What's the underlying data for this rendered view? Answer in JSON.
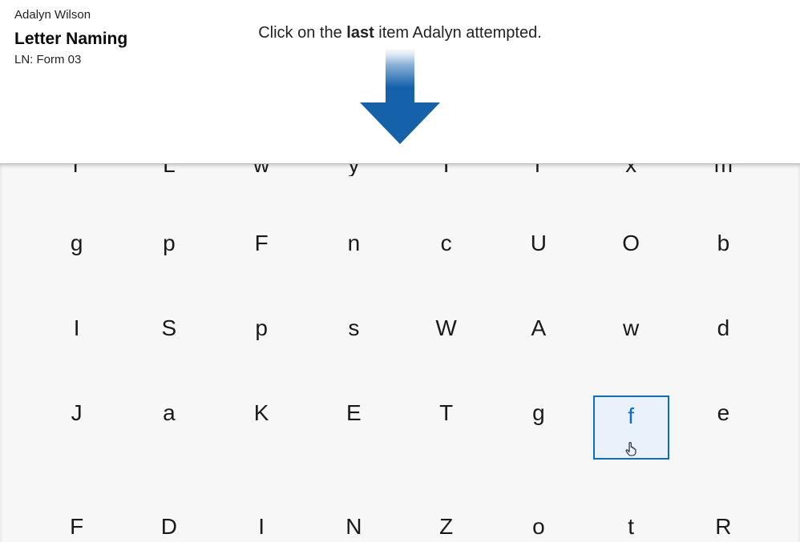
{
  "header": {
    "student_name": "Adalyn Wilson",
    "activity_name": "Letter Naming",
    "form_name": "LN: Form 03"
  },
  "instruction": {
    "prefix": "Click on the ",
    "bold": "last",
    "suffix": " item Adalyn attempted."
  },
  "grid": {
    "columns": 8,
    "selected": {
      "row": 3,
      "col": 6
    },
    "cells": [
      [
        "r",
        "L",
        "w",
        "y",
        "I",
        "r",
        "x",
        "m"
      ],
      [
        "g",
        "p",
        "F",
        "n",
        "c",
        "U",
        "O",
        "b"
      ],
      [
        "I",
        "S",
        "p",
        "s",
        "W",
        "A",
        "w",
        "d"
      ],
      [
        "J",
        "a",
        "K",
        "E",
        "T",
        "g",
        "f",
        "e"
      ],
      [
        "F",
        "D",
        "I",
        "N",
        "Z",
        "o",
        "t",
        "R"
      ]
    ]
  },
  "cursor_icon_name": "pointer-hand-icon"
}
